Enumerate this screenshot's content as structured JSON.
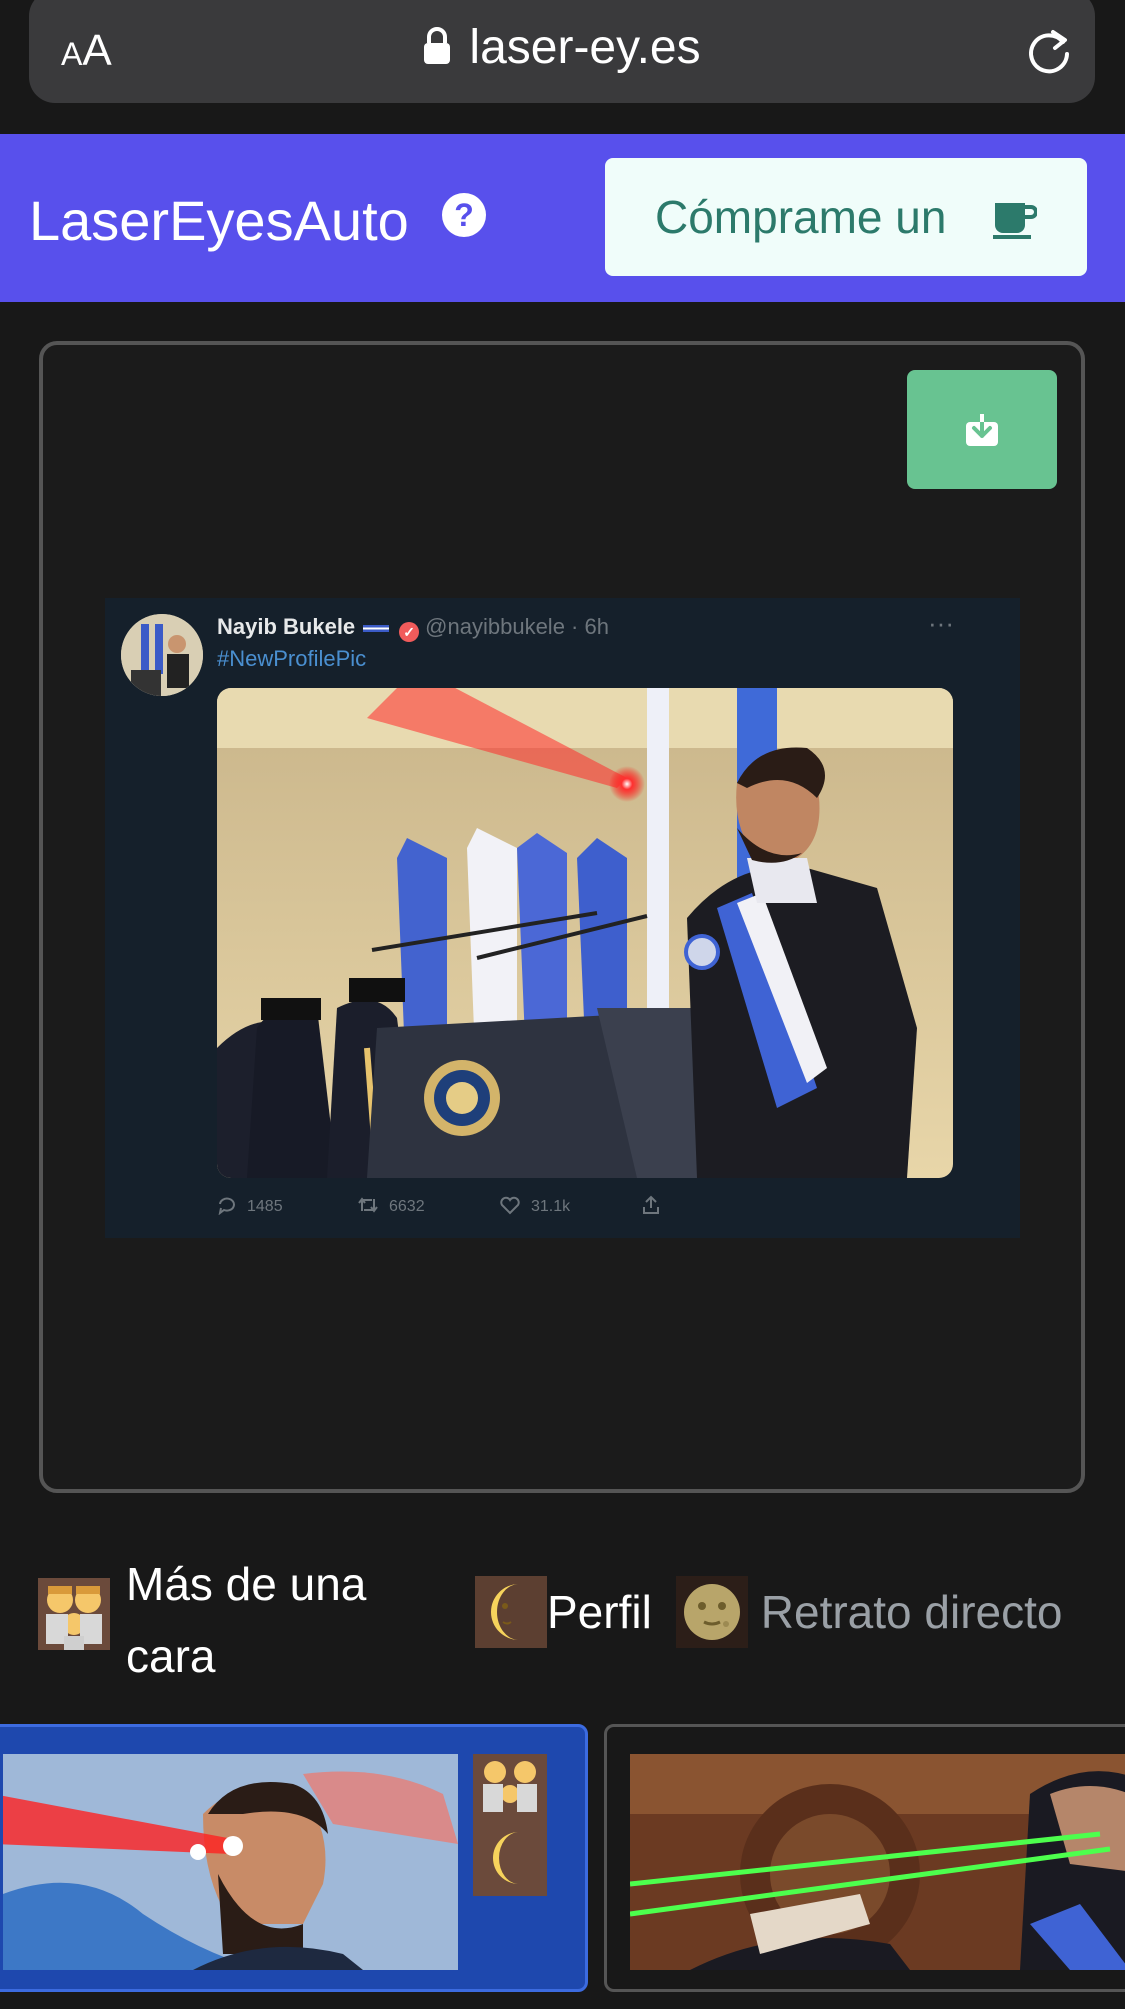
{
  "browser": {
    "text_size_label_small": "A",
    "text_size_label_large": "A",
    "url": "laser-ey.es"
  },
  "header": {
    "title": "LaserEyesAuto",
    "help_label": "?",
    "coffee_button_label": "Cómprame un",
    "accent_color": "#5850ec",
    "coffee_bg": "#f0fdfa"
  },
  "preview": {
    "download_color": "#68c391",
    "tweet": {
      "name": "Nayib Bukele",
      "handle": "@nayibbukele · 6h",
      "hashtag": "#NewProfilePic",
      "more": "···",
      "replies": "1485",
      "retweets": "6632",
      "likes": "31.1k"
    }
  },
  "modes": {
    "multi_face": "Más de una cara",
    "profile": "Perfil",
    "direct_portrait": "Retrato directo"
  },
  "icons": [
    "lock-icon",
    "reload-icon",
    "help-icon",
    "coffee-icon",
    "download-icon",
    "reply-icon",
    "retweet-icon",
    "like-icon",
    "share-icon",
    "family-emoji-icon",
    "moon-emoji-icon",
    "full-moon-face-icon"
  ]
}
